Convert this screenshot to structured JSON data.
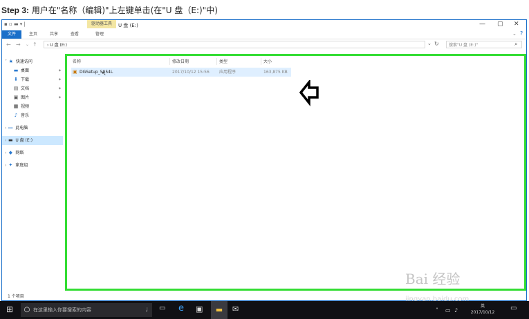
{
  "caption": {
    "step": "Step 3:",
    "text": "用户在\"名称（编辑)\"上左键单击(在\"U 盘（E:)\"中)"
  },
  "window": {
    "quick_access": "▪ ▫ ▬ ▾ |",
    "context_tab": "驱动器工具",
    "title": "U 盘 (E:)",
    "controls": {
      "minimize": "—",
      "maximize": "▢",
      "close": "✕"
    }
  },
  "ribbon": {
    "tabs": [
      "文件",
      "主页",
      "共享",
      "查看",
      "管理"
    ]
  },
  "address": {
    "path": "› U 盘 (E:)",
    "search_placeholder": "搜索\"U 盘 (E:)\""
  },
  "sidebar": {
    "items": [
      {
        "label": "快速访问",
        "icon": "star-icon",
        "glyph": "★",
        "color": "#1a6fc9"
      },
      {
        "label": "桌面",
        "icon": "desktop-icon",
        "glyph": "▬",
        "color": "#2a7ad0",
        "pinned": true
      },
      {
        "label": "下载",
        "icon": "download-icon",
        "glyph": "⬇",
        "color": "#2a7ad0",
        "pinned": true
      },
      {
        "label": "文档",
        "icon": "document-icon",
        "glyph": "▤",
        "color": "#555",
        "pinned": true
      },
      {
        "label": "图片",
        "icon": "picture-icon",
        "glyph": "▣",
        "color": "#555",
        "pinned": true
      },
      {
        "label": "视频",
        "icon": "video-icon",
        "glyph": "▦",
        "color": "#333"
      },
      {
        "label": "音乐",
        "icon": "music-icon",
        "glyph": "♪",
        "color": "#2a7ad0"
      },
      {
        "label": "此电脑",
        "icon": "computer-icon",
        "glyph": "▭",
        "color": "#2a7ad0"
      },
      {
        "label": "U 盘 (E:)",
        "icon": "usb-drive-icon",
        "glyph": "▬",
        "color": "#333",
        "selected": true
      },
      {
        "label": "网络",
        "icon": "network-icon",
        "glyph": "◆",
        "color": "#2a7ad0"
      },
      {
        "label": "家庭组",
        "icon": "homegroup-icon",
        "glyph": "✦",
        "color": "#2a7ad0"
      }
    ]
  },
  "table": {
    "columns": [
      "名称",
      "修改日期",
      "类型",
      "大小"
    ],
    "rows": [
      {
        "name": "DGSetup_5954L",
        "modified": "2017/10/12 15:56",
        "type": "应用程序",
        "size": "163,875 KB"
      }
    ]
  },
  "status": {
    "items": "1 个项目"
  },
  "taskbar": {
    "search_placeholder": "在这里输入你要搜索的内容",
    "time": "英",
    "date": "2017/10/12"
  },
  "watermark": {
    "text": "Bai 经验",
    "url": "jingyan.baidu.com"
  },
  "colors": {
    "highlight_border": "#33dd33",
    "selection": "#cce8ff",
    "file_tab": "#1a6fc9"
  }
}
